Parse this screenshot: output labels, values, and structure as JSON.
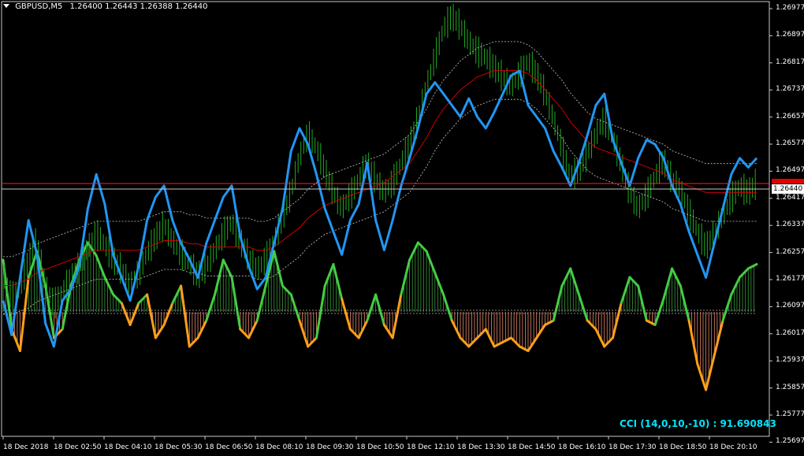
{
  "header": {
    "symbol": "GBPUSD,M5",
    "ohlc": "1.26400 1.26443 1.26388 1.26440"
  },
  "price_axis": [
    "1.26977",
    "1.26897",
    "1.26817",
    "1.26737",
    "1.26657",
    "1.26577",
    "1.26497",
    "1.26417",
    "1.26337",
    "1.26257",
    "1.26177",
    "1.26097",
    "1.26017",
    "1.25937",
    "1.25857",
    "1.25777",
    "1.25697"
  ],
  "current_price": "1.26440",
  "time_axis": [
    "18 Dec 2018",
    "18 Dec 02:50",
    "18 Dec 04:10",
    "18 Dec 05:30",
    "18 Dec 06:50",
    "18 Dec 08:10",
    "18 Dec 09:30",
    "18 Dec 10:50",
    "18 Dec 12:10",
    "18 Dec 13:30",
    "18 Dec 14:50",
    "18 Dec 16:10",
    "18 Dec 17:30",
    "18 Dec 18:50",
    "18 Dec 20:10"
  ],
  "indicator": {
    "label": "CCI (14,0,10,-10) : 91.690843"
  },
  "colors": {
    "background": "#000000",
    "candles": "#22aa22",
    "cci_line": "#2196f3",
    "ma_line": "#cc0000",
    "band_line": "#c8c8c8",
    "osc_up": "#44cc44",
    "osc_down": "#ff9f1a",
    "price_line": "#ff2020",
    "bid_line": "#c8c8c8"
  },
  "chart_data": {
    "type": "line",
    "ylim": [
      1.2565,
      1.27
    ],
    "xlabel": "",
    "ylabel": "",
    "close": [
      1.2616,
      1.2608,
      1.2611,
      1.262,
      1.2626,
      1.2612,
      1.2606,
      1.261,
      1.2614,
      1.2618,
      1.2624,
      1.2628,
      1.2625,
      1.262,
      1.2617,
      1.2612,
      1.2616,
      1.2622,
      1.2627,
      1.2631,
      1.2626,
      1.2622,
      1.2619,
      1.2615,
      1.2618,
      1.2623,
      1.2628,
      1.2632,
      1.2626,
      1.2621,
      1.2617,
      1.262,
      1.2626,
      1.2633,
      1.2641,
      1.2652,
      1.2659,
      1.2655,
      1.2648,
      1.2641,
      1.2636,
      1.264,
      1.2645,
      1.265,
      1.2645,
      1.2641,
      1.2644,
      1.265,
      1.2656,
      1.2664,
      1.2674,
      1.2683,
      1.2692,
      1.2696,
      1.2693,
      1.2688,
      1.2685,
      1.2683,
      1.268,
      1.2677,
      1.2674,
      1.2678,
      1.2682,
      1.2678,
      1.2672,
      1.2664,
      1.2655,
      1.2646,
      1.2648,
      1.2653,
      1.2659,
      1.2664,
      1.2658,
      1.265,
      1.2641,
      1.2636,
      1.264,
      1.2646,
      1.2651,
      1.2645,
      1.2642,
      1.2635,
      1.2629,
      1.2624,
      1.2628,
      1.2634,
      1.2639,
      1.2643,
      1.2641,
      1.2644
    ],
    "ma": [
      1.2612,
      1.2612,
      1.2613,
      1.2614,
      1.2616,
      1.2617,
      1.2618,
      1.2619,
      1.262,
      1.2621,
      1.2622,
      1.2623,
      1.2623,
      1.2623,
      1.2623,
      1.2623,
      1.2623,
      1.2624,
      1.2625,
      1.2626,
      1.2626,
      1.2626,
      1.2625,
      1.2625,
      1.2624,
      1.2624,
      1.2624,
      1.2624,
      1.2624,
      1.2624,
      1.2623,
      1.2623,
      1.2624,
      1.2626,
      1.2628,
      1.263,
      1.2633,
      1.2635,
      1.2637,
      1.2638,
      1.2639,
      1.264,
      1.2641,
      1.2642,
      1.2643,
      1.2644,
      1.2646,
      1.2648,
      1.265,
      1.2654,
      1.2658,
      1.2663,
      1.2667,
      1.267,
      1.2673,
      1.2675,
      1.2677,
      1.2678,
      1.2679,
      1.2679,
      1.2679,
      1.2679,
      1.2678,
      1.2676,
      1.2673,
      1.267,
      1.2667,
      1.2663,
      1.266,
      1.2657,
      1.2655,
      1.2654,
      1.2653,
      1.2652,
      1.2651,
      1.265,
      1.2649,
      1.2648,
      1.2647,
      1.2645,
      1.2644,
      1.2643,
      1.2642,
      1.2641,
      1.2641,
      1.2641,
      1.2641,
      1.2641,
      1.2641,
      1.2641
    ],
    "band_width": 0.0009,
    "cci_level": [
      0.2,
      0.05,
      0.3,
      0.55,
      0.4,
      0.1,
      0.0,
      0.2,
      0.25,
      0.35,
      0.6,
      0.75,
      0.62,
      0.4,
      0.3,
      0.2,
      0.35,
      0.55,
      0.65,
      0.7,
      0.55,
      0.45,
      0.38,
      0.3,
      0.45,
      0.55,
      0.65,
      0.7,
      0.48,
      0.35,
      0.25,
      0.3,
      0.45,
      0.6,
      0.85,
      0.95,
      0.88,
      0.75,
      0.6,
      0.5,
      0.4,
      0.55,
      0.62,
      0.8,
      0.55,
      0.42,
      0.55,
      0.7,
      0.82,
      0.95,
      1.1,
      1.15,
      1.1,
      1.05,
      1.0,
      1.08,
      1.0,
      0.95,
      1.02,
      1.1,
      1.18,
      1.2,
      1.05,
      1.0,
      0.95,
      0.85,
      0.78,
      0.7,
      0.8,
      0.92,
      1.05,
      1.1,
      0.9,
      0.8,
      0.7,
      0.82,
      0.9,
      0.88,
      0.82,
      0.7,
      0.62,
      0.5,
      0.4,
      0.3,
      0.45,
      0.6,
      0.75,
      0.82,
      0.78,
      0.82
    ],
    "oscillator": [
      120,
      -40,
      -90,
      80,
      140,
      60,
      -60,
      -40,
      60,
      120,
      160,
      130,
      80,
      40,
      20,
      -30,
      20,
      40,
      -60,
      -30,
      20,
      60,
      -80,
      -60,
      -20,
      40,
      120,
      80,
      -40,
      -60,
      -20,
      60,
      140,
      60,
      40,
      -20,
      -80,
      -60,
      60,
      110,
      30,
      -40,
      -60,
      -20,
      40,
      -30,
      -60,
      40,
      120,
      160,
      140,
      90,
      40,
      -20,
      -60,
      -80,
      -60,
      -40,
      -80,
      -70,
      -60,
      -80,
      -90,
      -60,
      -30,
      -20,
      60,
      100,
      40,
      -20,
      -40,
      -80,
      -60,
      20,
      80,
      60,
      -20,
      -30,
      30,
      100,
      60,
      -20,
      -120,
      -180,
      -100,
      -20,
      40,
      80,
      100,
      110
    ]
  }
}
